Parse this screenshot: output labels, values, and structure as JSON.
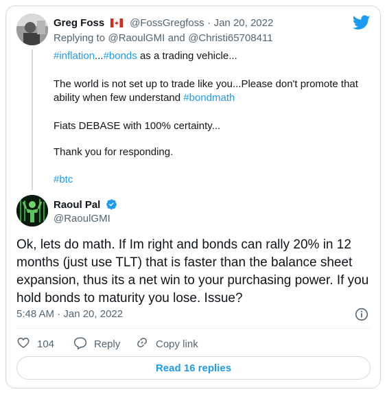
{
  "parent_tweet": {
    "display_name": "Greg Foss",
    "flag_emoji": "🇨🇦",
    "handle": "@FossGregfoss",
    "separator": "·",
    "date": "Jan 20, 2022",
    "replying_prefix": "Replying to",
    "reply_to_1": "@RaoulGMI",
    "reply_and": "and",
    "reply_to_2": "@Christi65708411",
    "line1_tag1": "#inflation",
    "line1_ellipsis": "...",
    "line1_tag2": "#bonds",
    "line1_rest": " as a trading vehicle...",
    "line2": "The world is not set up to trade like you...Please don't promote that",
    "line3_prefix": "ability when few understand ",
    "line3_tag": "#bondmath",
    "line4": "Fiats DEBASE with 100% certainty...",
    "line5": "Thank you for responding.",
    "line6_tag": "#btc"
  },
  "main_tweet": {
    "display_name": "Raoul Pal",
    "verified_icon": "verified-badge-icon",
    "handle": "@RaoulGMI",
    "text": "Ok, lets do math. If Im right and bonds can rally 20% in 12 months (just use TLT) that is faster than the balance sheet expansion, thus its a net win to your purchasing power. If you hold bonds to maturity you lose. Issue?",
    "timestamp": "5:48 AM · Jan 20, 2022"
  },
  "actions": {
    "like_count": "104",
    "reply_label": "Reply",
    "copy_link_label": "Copy link"
  },
  "read_replies_label": "Read 16 replies",
  "colors": {
    "accent": "#1d9bf0",
    "text": "#0f1419",
    "muted": "#536471",
    "border": "#cfd9de",
    "flag_red": "#d52b1e"
  }
}
